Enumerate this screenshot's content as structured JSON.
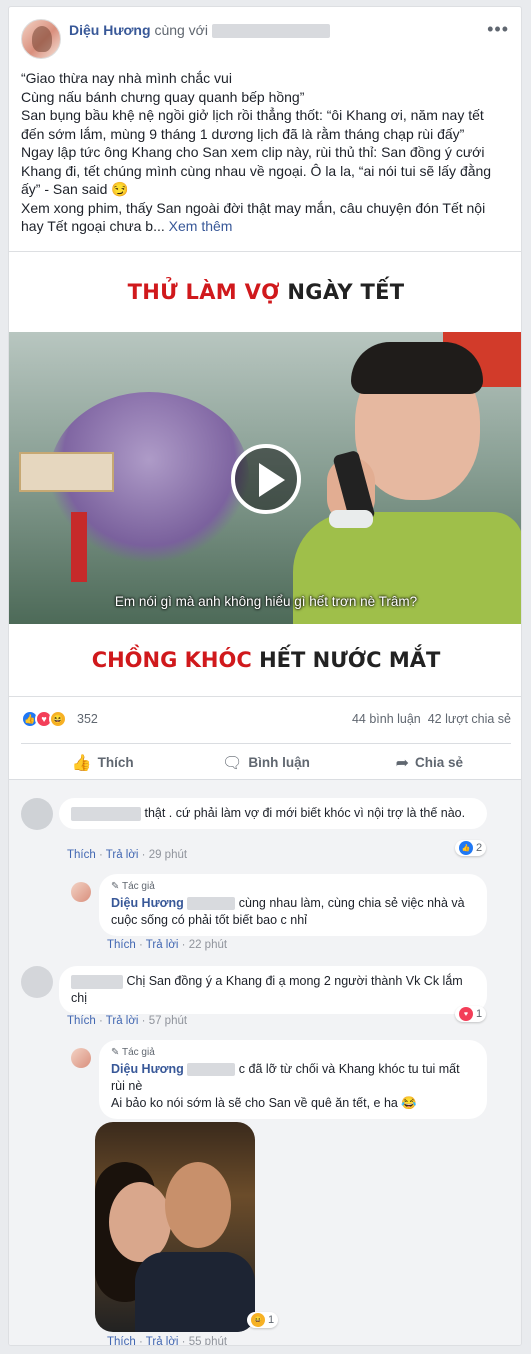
{
  "post": {
    "author": "Diệu Hương",
    "with_text": "cùng với",
    "more_icon": "more-horizontal-icon",
    "lines": [
      "“Giao thừa nay nhà mình chắc vui",
      "Cùng nấu bánh chưng quay quanh bếp hồng”",
      "San bụng bầu khệ nệ ngồi giở lịch rồi thẳng thốt: “ôi Khang ơi, năm nay tết đến sớm lắm, mùng 9 tháng 1 dương lịch đã là rằm tháng chạp rùi đấy”",
      "Ngay lập tức ông Khang cho San xem clip này, rùi thủ thỉ: San đồng ý cưới Khang đi, tết chúng mình cùng nhau về ngoại. Ô la la, “ai nói tui sẽ lấy đằng ấy” - San said 😏",
      "Xem xong phim, thấy San ngoài đời thật may mắn, câu chuyện đón Tết nội hay Tết ngoại chưa b..."
    ],
    "see_more": "Xem thêm"
  },
  "media": {
    "title_red": "THỬ LÀM VỢ",
    "title_dark": "NGÀY TẾT",
    "subtitle": "Em nói gì mà anh không hiểu gì hết trơn nè Trâm?",
    "bottom_red": "CHỒNG KHÓC",
    "bottom_dark": "HẾT NƯỚC MẮT",
    "play_icon": "play-icon"
  },
  "stats": {
    "reactions": "352",
    "comments": "44 bình luận",
    "shares": "42 lượt chia sẻ"
  },
  "actions": {
    "like": "Thích",
    "comment": "Bình luận",
    "share": "Chia sẻ"
  },
  "comments": [
    {
      "text": "thật . cứ phải làm vợ đi mới biết khóc vì nội trợ là thế nào.",
      "like": "Thích",
      "reply": "Trả lời",
      "time": "29 phút",
      "reactions": "2"
    },
    {
      "badge": "Tác giả",
      "name": "Diệu Hương",
      "text": "cùng nhau làm, cùng chia sẻ việc nhà và cuộc sống có phải tốt biết bao c nhỉ",
      "like": "Thích",
      "reply": "Trả lời",
      "time": "22 phút"
    },
    {
      "text": "Chị San đồng ý a Khang đi ạ mong 2 người thành Vk Ck lắm chị",
      "like": "Thích",
      "reply": "Trả lời",
      "time": "57 phút",
      "reactions": "1"
    },
    {
      "badge": "Tác giả",
      "name": "Diệu Hương",
      "text": "c đã lỡ từ chối và Khang khóc tu tui mất rùi nè",
      "text2": "Ai bảo ko nói sớm là sẽ cho San về quê ăn tết, e ha 😂",
      "like": "Thích",
      "reply": "Trả lời",
      "time": "55 phút",
      "reactions": "1"
    }
  ],
  "colors": {
    "link": "#385898",
    "accent_red": "#d0191c",
    "like_blue": "#2078f4",
    "love_red": "#f33e58",
    "haha_yellow": "#f7b125"
  }
}
